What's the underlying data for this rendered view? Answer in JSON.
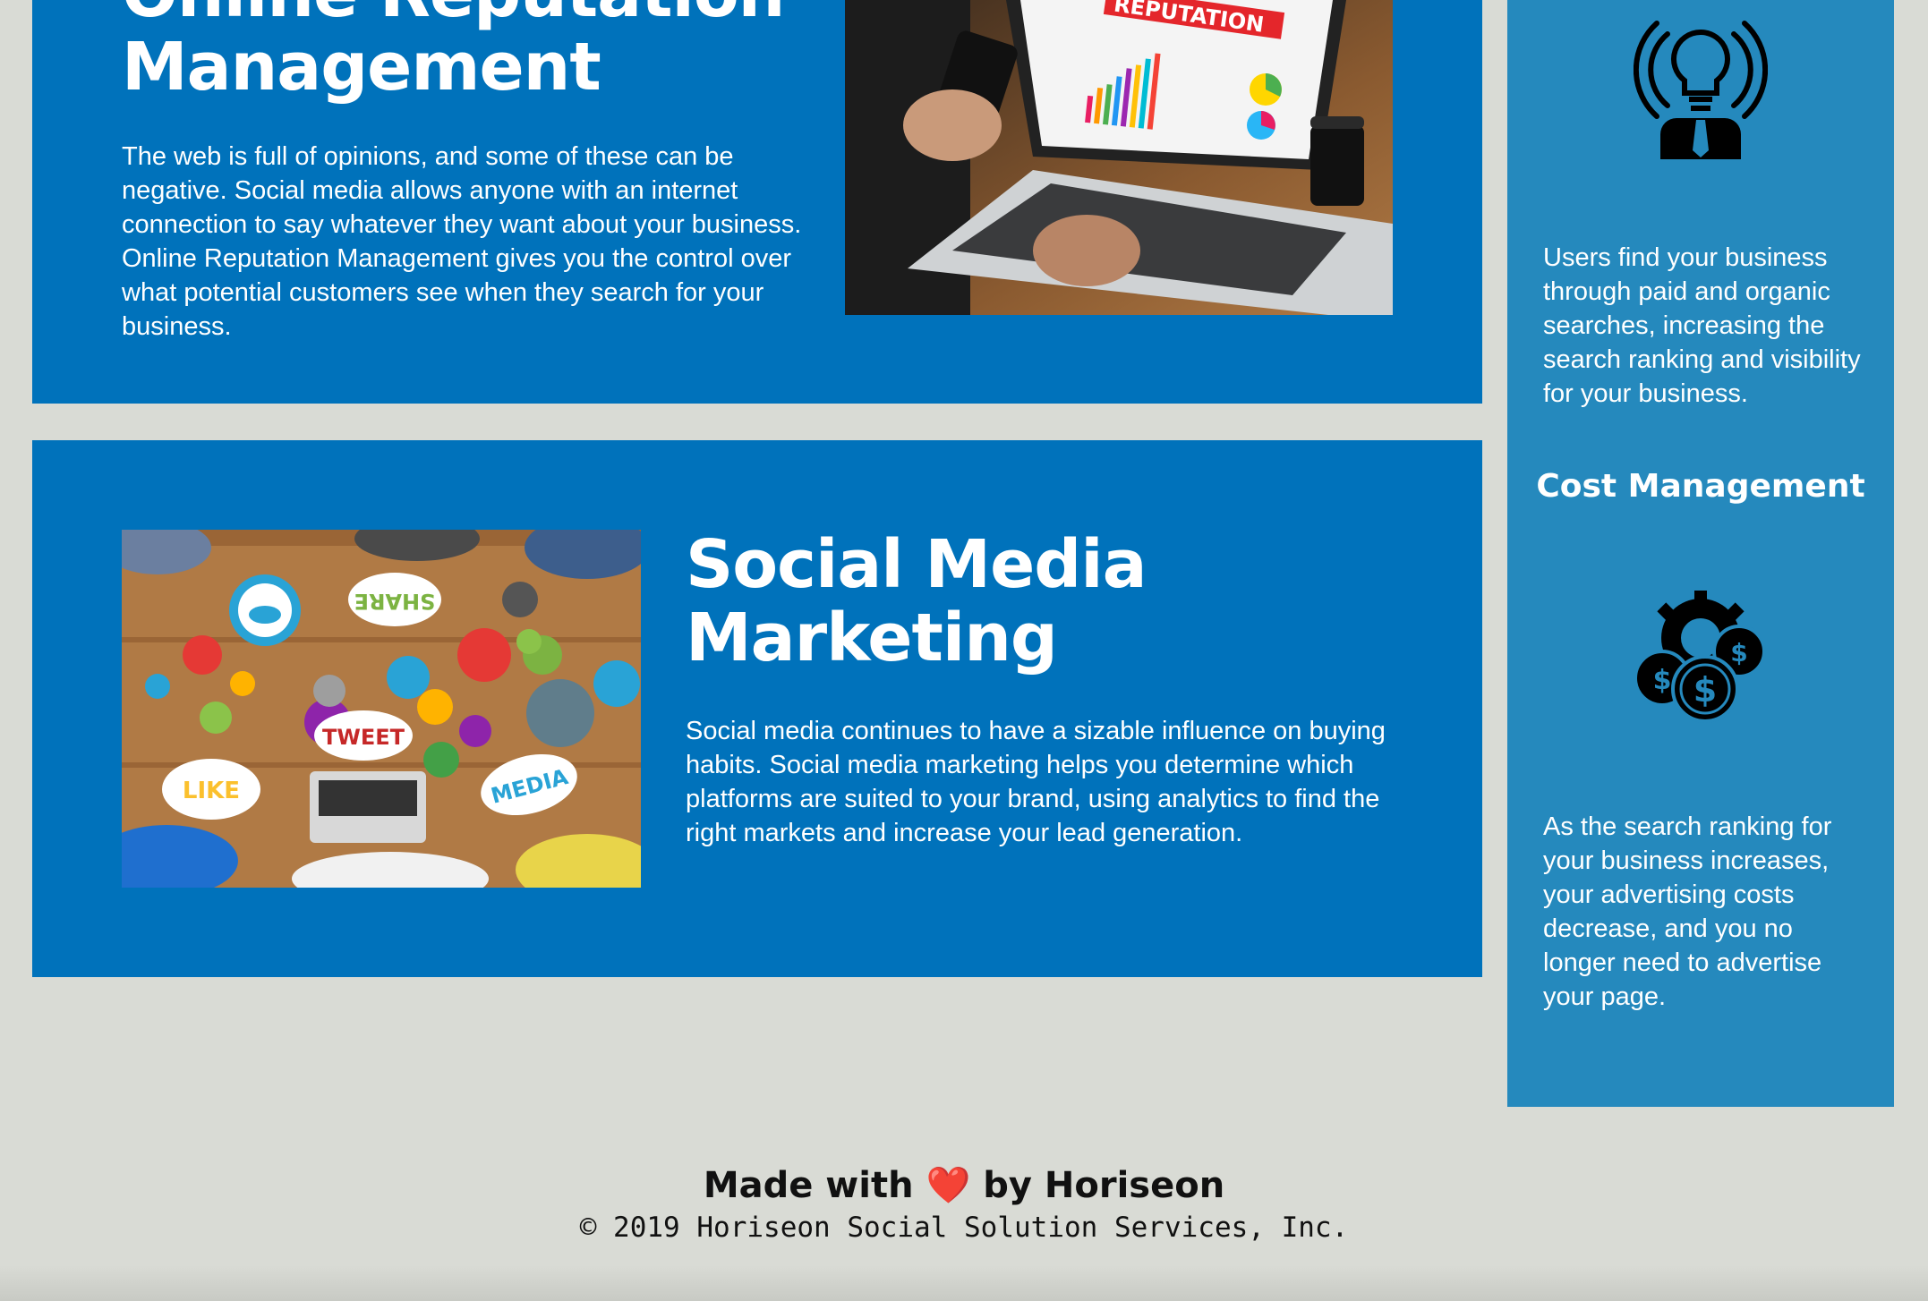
{
  "reputation": {
    "title": "Online Reputation Management",
    "text": "The web is full of opinions, and some of these can be negative. Social media allows anyone with an internet connection to say whatever they want about your business. Online Reputation Management gives you the control over what potential customers see when they search for your business.",
    "image_label": "REPUTATION"
  },
  "social": {
    "title": "Social Media Marketing",
    "text": "Social media continues to have a sizable influence on buying habits. Social media marketing helps you determine which platforms are suited to your brand, using analytics to find the right markets and increase your lead generation.",
    "image_words": {
      "share": "SHARE",
      "tweet": "TWEET",
      "like": "LIKE",
      "media": "MEDIA"
    }
  },
  "sidebar": {
    "seo_text": "Users find your business through paid and organic searches, increasing the search ranking and visibility for your business.",
    "cost_title": "Cost Management",
    "cost_text": "As the search ranking for your business increases, your advertising costs decrease, and you no longer need to advertise your page."
  },
  "footer": {
    "made_prefix": "Made with",
    "heart": "❤️",
    "made_suffix": "by Horiseon",
    "copyright": "© 2019 Horiseon Social Solution Services, Inc."
  },
  "colors": {
    "card": "#0072bb",
    "sidebar": "#2589bd",
    "background": "#d9dbd5"
  }
}
